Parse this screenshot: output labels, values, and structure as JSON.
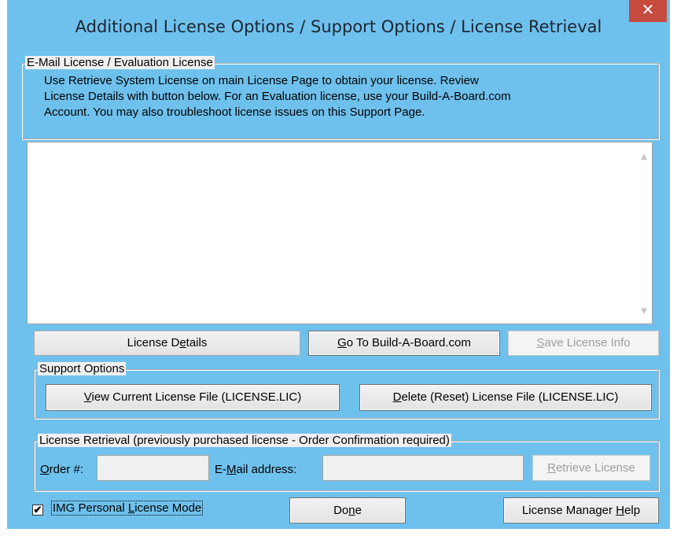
{
  "window": {
    "title": "Additional License Options / Support Options / License Retrieval",
    "close_glyph": "✕"
  },
  "email_group": {
    "label": "E-Mail License / Evaluation License",
    "description_lines": [
      "Use Retrieve System License on main License Page to obtain your license.  Review",
      "License Details with button below.  For an Evaluation license, use your Build-A-Board.com",
      "Account.  You may also troubleshoot license issues on this Support Page."
    ],
    "license_text": ""
  },
  "license_buttons": {
    "details": {
      "pre": "License D",
      "key": "e",
      "post": "tails"
    },
    "goto": {
      "pre": "",
      "key": "G",
      "post": "o To Build-A-Board.com"
    },
    "save": {
      "pre": "",
      "key": "S",
      "post": "ave License Info",
      "enabled": false
    }
  },
  "support_group": {
    "label": "Support Options",
    "view_button": {
      "pre": "",
      "key": "V",
      "post": "iew Current License File (LICENSE.LIC)"
    },
    "delete_button": {
      "pre": "",
      "key": "D",
      "post": "elete (Reset) License File (LICENSE.LIC)"
    }
  },
  "retrieval_group": {
    "label": "License Retrieval (previously purchased license - Order Confirmation required)",
    "order_label": {
      "pre": "",
      "key": "O",
      "post": "rder #:"
    },
    "order_value": "",
    "email_label": {
      "pre": "E-",
      "key": "M",
      "post": "ail address:"
    },
    "email_value": "",
    "retrieve_button": {
      "pre": "",
      "key": "R",
      "post": "etrieve License",
      "enabled": false
    }
  },
  "footer": {
    "personal_mode": {
      "checked": true,
      "check_glyph": "✔",
      "pre": "IMG Personal ",
      "key": "L",
      "post": "icense Mode"
    },
    "done_button": {
      "pre": "Do",
      "key": "n",
      "post": "e"
    },
    "help_button": {
      "pre": "License Manager ",
      "key": "H",
      "post": "elp"
    }
  },
  "icons": {
    "scroll_up": "▲",
    "scroll_down": "▼"
  },
  "colors": {
    "title_bar": "#6fc1ed",
    "close_button": "#c74a3e",
    "dialog_bg": "#f0f0f0"
  }
}
